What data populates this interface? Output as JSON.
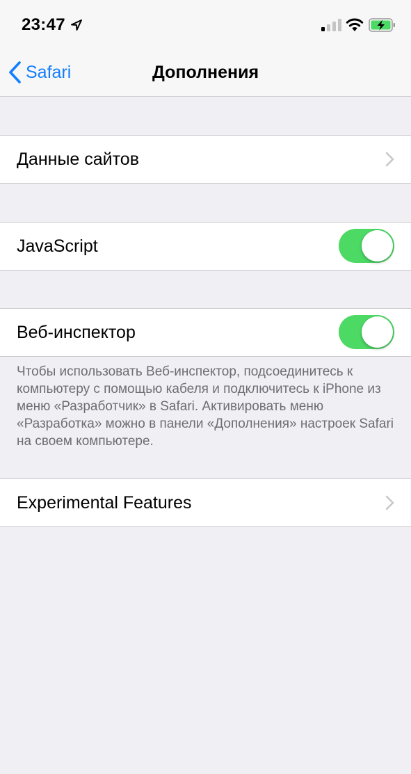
{
  "status_bar": {
    "time": "23:47",
    "location_icon": "location-arrow-icon",
    "signal_icon": "cellular-signal-icon",
    "wifi_icon": "wifi-icon",
    "battery_icon": "battery-charging-icon"
  },
  "nav": {
    "back_label": "Safari",
    "title": "Дополнения"
  },
  "rows": {
    "website_data": {
      "label": "Данные сайтов"
    },
    "javascript": {
      "label": "JavaScript",
      "enabled": true
    },
    "web_inspector": {
      "label": "Веб-инспектор",
      "enabled": true,
      "footer": "Чтобы использовать Веб-инспектор, подсоединитесь к компьютеру с помощью кабеля и подключитесь к iPhone из меню «Разработчик» в Safari. Активировать меню «Разработка» можно в панели «Дополнения» настроек Safari на своем компьютере."
    },
    "experimental": {
      "label": "Experimental Features"
    }
  },
  "colors": {
    "accent": "#147efb",
    "toggle_on": "#4cd964",
    "group_background": "#efeff4",
    "footer_text": "#6d6d72"
  }
}
